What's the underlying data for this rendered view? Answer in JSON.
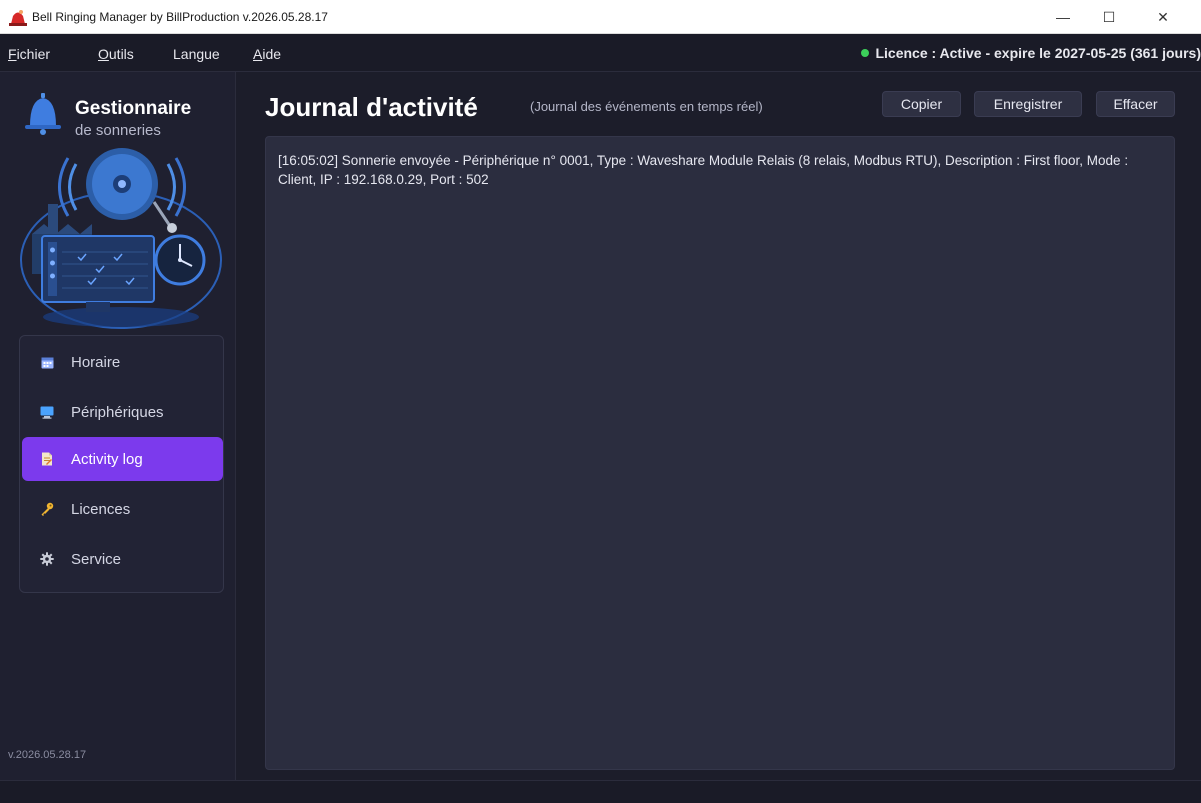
{
  "window": {
    "title": "Bell Ringing Manager by BillProduction  v.2026.05.28.17",
    "minimize_glyph": "—",
    "maximize_glyph": "☐",
    "close_glyph": "✕"
  },
  "menu": {
    "items": [
      {
        "first": "F",
        "rest": "ichier"
      },
      {
        "first": "O",
        "rest": "utils"
      },
      {
        "first": "",
        "rest": "Langue"
      },
      {
        "first": "A",
        "rest": "ide"
      }
    ],
    "licence_status": "Licence : Active - expire le 2027-05-25 (361 jours)",
    "licence_color": "#3ccf5a"
  },
  "sidebar": {
    "logo_title": "Gestionnaire",
    "logo_subtitle": "de sonneries",
    "nav": [
      {
        "label": "Horaire",
        "icon": "calendar-icon",
        "active": false
      },
      {
        "label": "Périphériques",
        "icon": "monitor-icon",
        "active": false
      },
      {
        "label": "Activity log",
        "icon": "log-icon",
        "active": true
      },
      {
        "label": "Licences",
        "icon": "key-icon",
        "active": false
      },
      {
        "label": "Service",
        "icon": "gear-icon",
        "active": false
      }
    ],
    "version": "v.2026.05.28.17",
    "accent": "#7c3aed"
  },
  "main": {
    "title": "Journal d'activité",
    "subtitle": "(Journal des événements en temps réel)",
    "buttons": {
      "copy": "Copier",
      "save": "Enregistrer",
      "clear": "Effacer"
    },
    "log_lines": [
      "[16:05:02]  Sonnerie envoyée - Périphérique n° 0001, Type : Waveshare Module Relais (8 relais, Modbus RTU), Description : First floor, Mode : Client, IP : 192.168.0.29, Port : 502"
    ]
  }
}
